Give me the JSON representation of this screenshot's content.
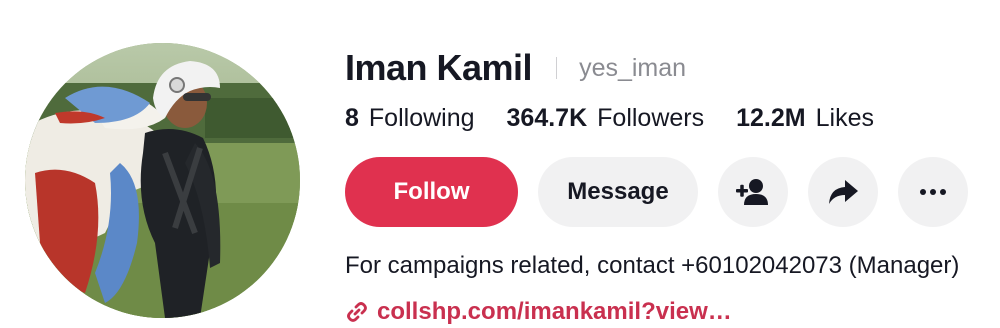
{
  "profile": {
    "display_name": "Iman Kamil",
    "username": "yes_iman"
  },
  "stats": [
    {
      "value": "8",
      "label": "Following"
    },
    {
      "value": "364.7K",
      "label": "Followers"
    },
    {
      "value": "12.2M",
      "label": "Likes"
    }
  ],
  "actions": {
    "follow_label": "Follow",
    "message_label": "Message",
    "add_friend_icon": "add-person-icon",
    "share_icon": "share-arrow-icon",
    "more_icon": "more-dots-icon"
  },
  "bio": {
    "text": "For campaigns related, contact +60102042073 (Manager)",
    "link_text": "collshp.com/imankamil?view…",
    "link_icon": "link-icon"
  },
  "colors": {
    "follow_bg": "#e0314f",
    "link": "#c9304f",
    "button_gray": "#f1f1f2",
    "username": "#8a8b91"
  }
}
